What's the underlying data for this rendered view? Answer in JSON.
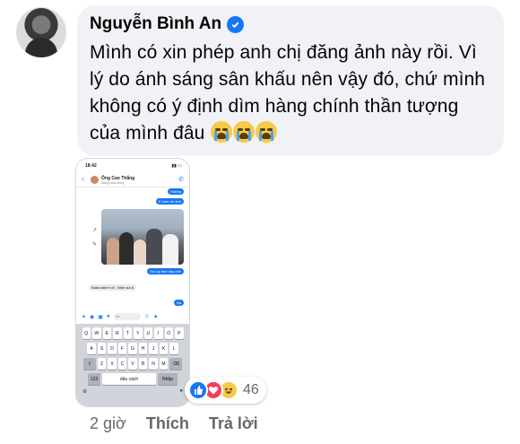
{
  "comment": {
    "author": "Nguyễn Bình An",
    "verified_icon": "verified-badge-icon",
    "text": "Mình có xin phép anh chị đăng ảnh này rồi. Vì lý do ánh sáng sân khấu nên vậy đó, chứ mình không có ý định dìm hàng chính thần tượng của mình đâu",
    "emojis": [
      "crying-face-icon",
      "crying-face-icon",
      "crying-face-icon"
    ]
  },
  "screenshot": {
    "time": "18:42",
    "contact_name": "Ông Cao Thắng",
    "contact_status": "Đang hoạt động",
    "messages": [
      {
        "from": "me",
        "text": "Hahha"
      },
      {
        "from": "me",
        "text": "E cám ơn anh"
      },
      {
        "from": "me",
        "text": "Em up ảnh này nhé"
      },
      {
        "from": "them",
        "text": "Kaka okie e ơi . Nhìn vui à"
      },
      {
        "from": "me",
        "text": "Dạ"
      }
    ],
    "input_placeholder": "Aa",
    "keyboard": {
      "row1": [
        "Q",
        "W",
        "E",
        "R",
        "T",
        "Y",
        "U",
        "I",
        "O",
        "P"
      ],
      "row2": [
        "A",
        "S",
        "D",
        "F",
        "G",
        "H",
        "J",
        "K",
        "L"
      ],
      "row3": [
        "Z",
        "X",
        "C",
        "V",
        "B",
        "N",
        "M"
      ],
      "num_key": "123",
      "space_key": "dấu cách",
      "return_key": "Nhập"
    }
  },
  "reactions": {
    "icons": [
      "like-icon",
      "love-icon",
      "haha-icon"
    ],
    "count": "46"
  },
  "actions": {
    "time": "2 giờ",
    "like": "Thích",
    "reply": "Trả lời"
  },
  "colors": {
    "accent": "#1877f2",
    "bubble": "#f0f2f5",
    "muted": "#65676b"
  }
}
